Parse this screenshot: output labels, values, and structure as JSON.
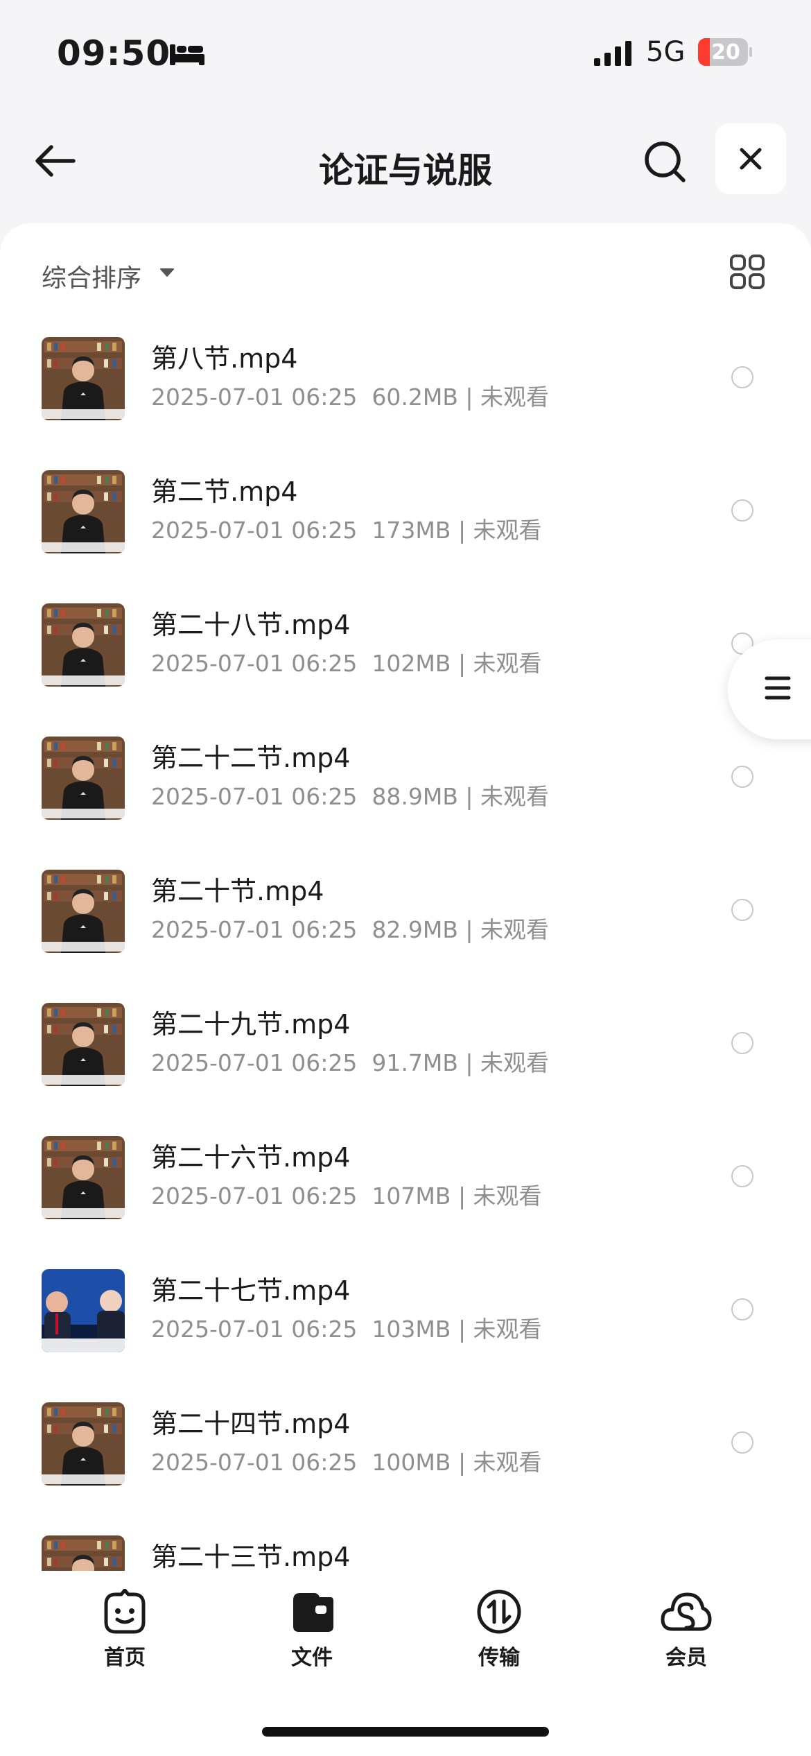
{
  "status_bar": {
    "time": "09:50",
    "network": "5G",
    "battery": "20"
  },
  "header": {
    "title": "论证与说服"
  },
  "toolbar": {
    "sort_label": "综合排序"
  },
  "files": [
    {
      "name": "第八节.mp4",
      "meta": "2025-07-01 06:25  60.2MB | 未观看",
      "thumb": "lecture"
    },
    {
      "name": "第二节.mp4",
      "meta": "2025-07-01 06:25  173MB | 未观看",
      "thumb": "lecture"
    },
    {
      "name": "第二十八节.mp4",
      "meta": "2025-07-01 06:25  102MB | 未观看",
      "thumb": "lecture"
    },
    {
      "name": "第二十二节.mp4",
      "meta": "2025-07-01 06:25  88.9MB | 未观看",
      "thumb": "lecture"
    },
    {
      "name": "第二十节.mp4",
      "meta": "2025-07-01 06:25  82.9MB | 未观看",
      "thumb": "lecture"
    },
    {
      "name": "第二十九节.mp4",
      "meta": "2025-07-01 06:25  91.7MB | 未观看",
      "thumb": "lecture"
    },
    {
      "name": "第二十六节.mp4",
      "meta": "2025-07-01 06:25  107MB | 未观看",
      "thumb": "lecture"
    },
    {
      "name": "第二十七节.mp4",
      "meta": "2025-07-01 06:25  103MB | 未观看",
      "thumb": "debate"
    },
    {
      "name": "第二十四节.mp4",
      "meta": "2025-07-01 06:25  100MB | 未观看",
      "thumb": "lecture"
    },
    {
      "name": "第二十三节.mp4",
      "meta": "",
      "thumb": "lecture"
    }
  ],
  "tabbar": {
    "home": "首页",
    "files": "文件",
    "transfer": "传输",
    "member": "会员"
  },
  "colors": {
    "accent": "#1a1a1a",
    "meta": "#8e8e93",
    "bg": "#f5f5f7"
  }
}
